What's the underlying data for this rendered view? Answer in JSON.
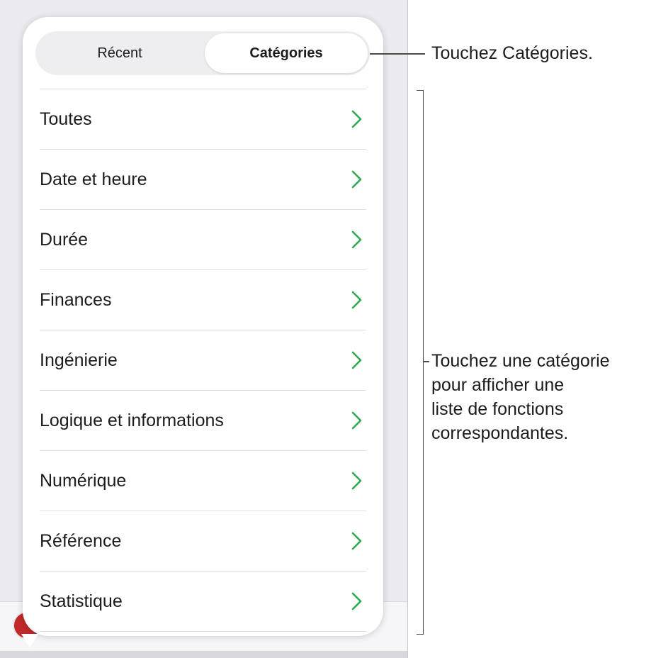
{
  "segmented_control": {
    "recent_label": "Récent",
    "categories_label": "Catégories",
    "selected": "Catégories"
  },
  "categories": [
    {
      "label": "Toutes"
    },
    {
      "label": "Date et heure"
    },
    {
      "label": "Durée"
    },
    {
      "label": "Finances"
    },
    {
      "label": "Ingénierie"
    },
    {
      "label": "Logique et informations"
    },
    {
      "label": "Numérique"
    },
    {
      "label": "Référence"
    },
    {
      "label": "Statistique"
    }
  ],
  "callouts": {
    "tap_categories": "Touchez Catégories.",
    "tap_category_lines": [
      "Touchez une catégorie",
      "pour afficher une",
      "liste de fonctions",
      "correspondantes."
    ]
  },
  "colors": {
    "chevron": "#34a853",
    "popover_background": "#ffffff",
    "app_background": "#ececf0"
  },
  "icons": {
    "row_disclosure": "chevron-right-icon"
  }
}
